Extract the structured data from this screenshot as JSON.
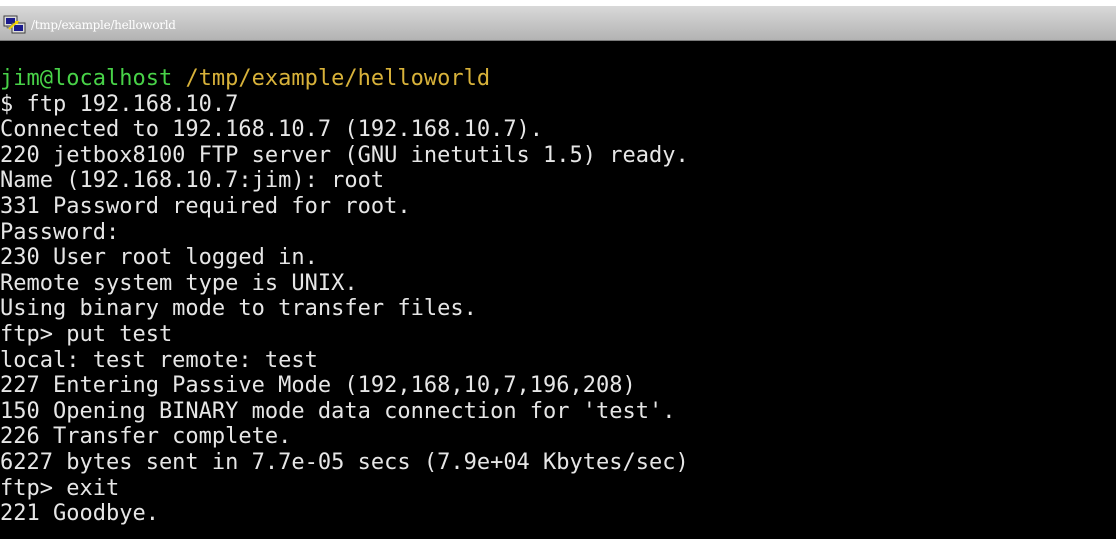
{
  "window": {
    "title": "/tmp/example/helloworld",
    "icon": "putty-terminal-icon"
  },
  "terminal": {
    "colors": {
      "background": "#000000",
      "foreground": "#e6e6e6",
      "prompt_user": "#48d248",
      "prompt_path": "#d8b23a"
    },
    "prompt": {
      "user_host": "jim@localhost",
      "path": "/tmp/example/helloworld"
    },
    "lines": [
      "$ ftp 192.168.10.7",
      "Connected to 192.168.10.7 (192.168.10.7).",
      "220 jetbox8100 FTP server (GNU inetutils 1.5) ready.",
      "Name (192.168.10.7:jim): root",
      "331 Password required for root.",
      "Password:",
      "230 User root logged in.",
      "Remote system type is UNIX.",
      "Using binary mode to transfer files.",
      "ftp> put test",
      "local: test remote: test",
      "227 Entering Passive Mode (192,168,10,7,196,208)",
      "150 Opening BINARY mode data connection for 'test'.",
      "226 Transfer complete.",
      "6227 bytes sent in 7.7e-05 secs (7.9e+04 Kbytes/sec)",
      "ftp> exit",
      "221 Goodbye."
    ]
  }
}
